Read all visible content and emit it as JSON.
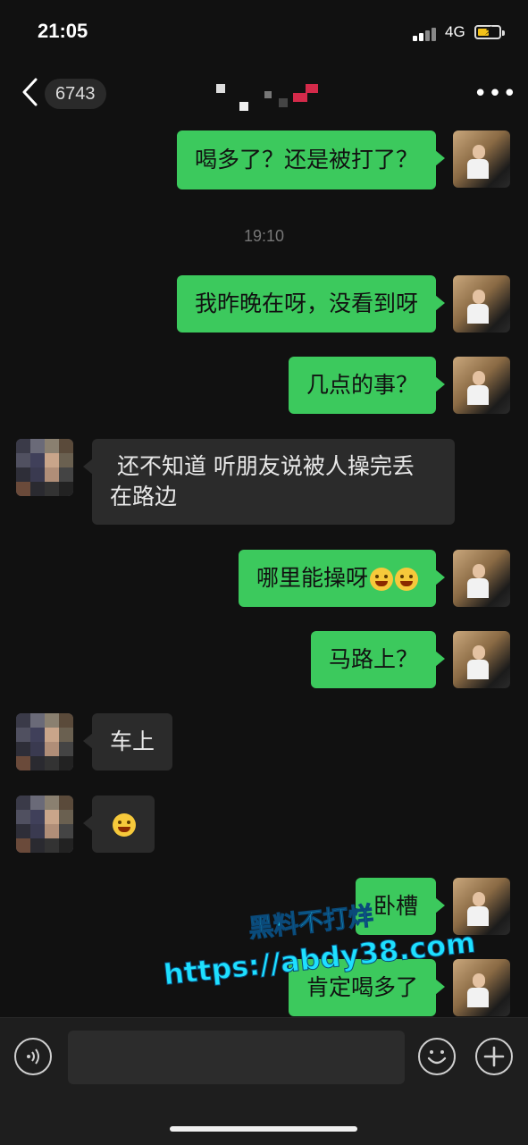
{
  "status_bar": {
    "time": "21:05",
    "network": "4G"
  },
  "header": {
    "unread_count": "6743"
  },
  "messages": [
    {
      "from": "me",
      "text": "喝多了？还是被打了？"
    },
    {
      "type": "time",
      "text": "19:10"
    },
    {
      "from": "me",
      "text": "我昨晚在呀，没看到呀"
    },
    {
      "from": "me",
      "text": "几点的事？"
    },
    {
      "from": "them",
      "line1": " 还不知道 听朋友说被人操完丢",
      "line2": "在路边"
    },
    {
      "from": "me",
      "text": "哪里能操呀",
      "emoji": "laughing-crying-emoji"
    },
    {
      "from": "me",
      "text": "马路上？"
    },
    {
      "from": "them",
      "text": "车上"
    },
    {
      "from": "them",
      "emoji": "laughing-crying-emoji"
    },
    {
      "from": "me",
      "text": "卧槽"
    },
    {
      "from": "me",
      "text": "肯定喝多了"
    }
  ],
  "watermark": {
    "line1": "黑料不打烊",
    "line2": "https://abdy38.com"
  },
  "input_bar": {
    "placeholder": ""
  },
  "colors": {
    "sent_bubble": "#3cc95d",
    "received_bubble": "#2b2b2b",
    "background": "#111111"
  }
}
